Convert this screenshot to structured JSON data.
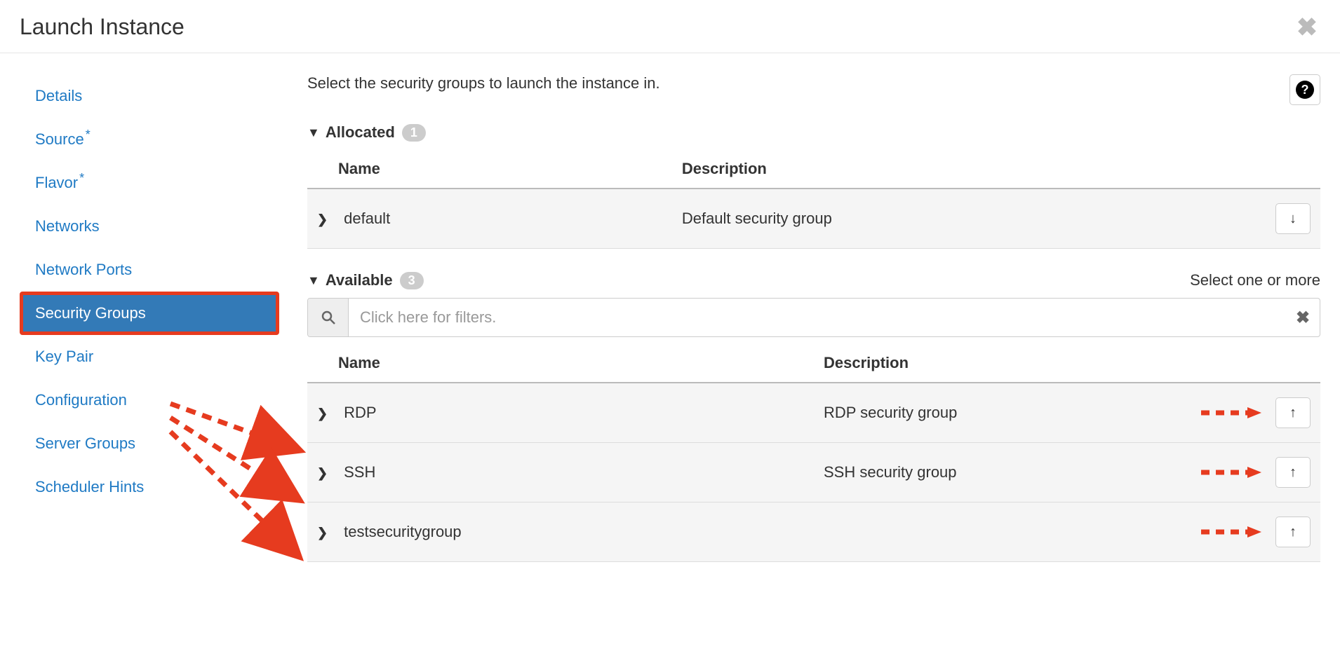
{
  "modal": {
    "title": "Launch Instance"
  },
  "sidebar": {
    "items": [
      {
        "label": "Details",
        "required": false,
        "active": false
      },
      {
        "label": "Source",
        "required": true,
        "active": false
      },
      {
        "label": "Flavor",
        "required": true,
        "active": false
      },
      {
        "label": "Networks",
        "required": false,
        "active": false
      },
      {
        "label": "Network Ports",
        "required": false,
        "active": false
      },
      {
        "label": "Security Groups",
        "required": false,
        "active": true
      },
      {
        "label": "Key Pair",
        "required": false,
        "active": false
      },
      {
        "label": "Configuration",
        "required": false,
        "active": false
      },
      {
        "label": "Server Groups",
        "required": false,
        "active": false
      },
      {
        "label": "Scheduler Hints",
        "required": false,
        "active": false
      }
    ]
  },
  "main": {
    "description": "Select the security groups to launch the instance in.",
    "allocated": {
      "label": "Allocated",
      "count": "1",
      "columns": {
        "name": "Name",
        "description": "Description"
      },
      "rows": [
        {
          "name": "default",
          "description": "Default security group"
        }
      ]
    },
    "available": {
      "label": "Available",
      "count": "3",
      "hint": "Select one or more",
      "filter_placeholder": "Click here for filters.",
      "columns": {
        "name": "Name",
        "description": "Description"
      },
      "rows": [
        {
          "name": "RDP",
          "description": "RDP security group"
        },
        {
          "name": "SSH",
          "description": "SSH security group"
        },
        {
          "name": "testsecuritygroup",
          "description": ""
        }
      ]
    }
  }
}
